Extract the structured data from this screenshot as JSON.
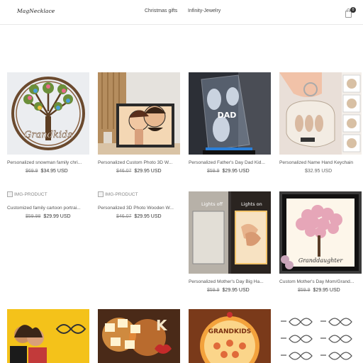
{
  "header": {
    "logo": "MagNecklace",
    "nav": [
      "Christmas gifts",
      "Infinity-Jewelry"
    ],
    "cart_count": "0"
  },
  "products": [
    {
      "title": "Personalized snowman family chri...",
      "old_price": "$69.9",
      "price": "$34.95 USD",
      "image": "tree-wall-sign"
    },
    {
      "title": "Personalized Custom Photo 3D W...",
      "old_price": "$46.07",
      "price": "$29.95 USD",
      "image": "couple-photo-frame"
    },
    {
      "title": "Personalized Father's Day Dad Kid...",
      "old_price": "$59.9",
      "price": "$29.95 USD",
      "image": "dad-night-lamp"
    },
    {
      "title": "Personalized Name Hand Keychain",
      "old_price": "",
      "price": "$32.95 USD",
      "image": "hand-keychain"
    },
    {
      "title": "Customized family cartoon portrai...",
      "old_price": "$59.98",
      "price": "$29.99 USD",
      "image": "IMG-PRODUCT"
    },
    {
      "title": "Personalized 3D Photo Wooden W...",
      "old_price": "$46.07",
      "price": "$29.95 USD",
      "image": "IMG-PRODUCT"
    },
    {
      "title": "Personalized Mother's Day Big Ha...",
      "old_price": "$59.9",
      "price": "$29.95 USD",
      "image": "mirror-lights"
    },
    {
      "title": "Custom Mother's Day Mom/Grand...",
      "old_price": "$59.9",
      "price": "$29.95 USD",
      "image": "flower-shadow-box"
    },
    {
      "title": "",
      "old_price": "",
      "price": "",
      "image": "couple-infinity-sign"
    },
    {
      "title": "",
      "old_price": "",
      "price": "",
      "image": "photo-letter-lamp"
    },
    {
      "title": "",
      "old_price": "",
      "price": "",
      "image": "grandkids-ornament"
    },
    {
      "title": "",
      "old_price": "",
      "price": "",
      "image": "infinity-name-necklaces"
    }
  ],
  "broken_image_alt": "IMG-PRODUCT",
  "thumb_texts": {
    "grandkids": "Grandkids",
    "dad": "DAD",
    "lights_off": "Lights off",
    "lights_on": "Lights on",
    "granddaughter": "Granddaughter",
    "grandkids2": "GRANDKIDS"
  },
  "colors": {
    "header_border": "#e8e8e8",
    "text": "#333333",
    "old_price": "#888888"
  }
}
